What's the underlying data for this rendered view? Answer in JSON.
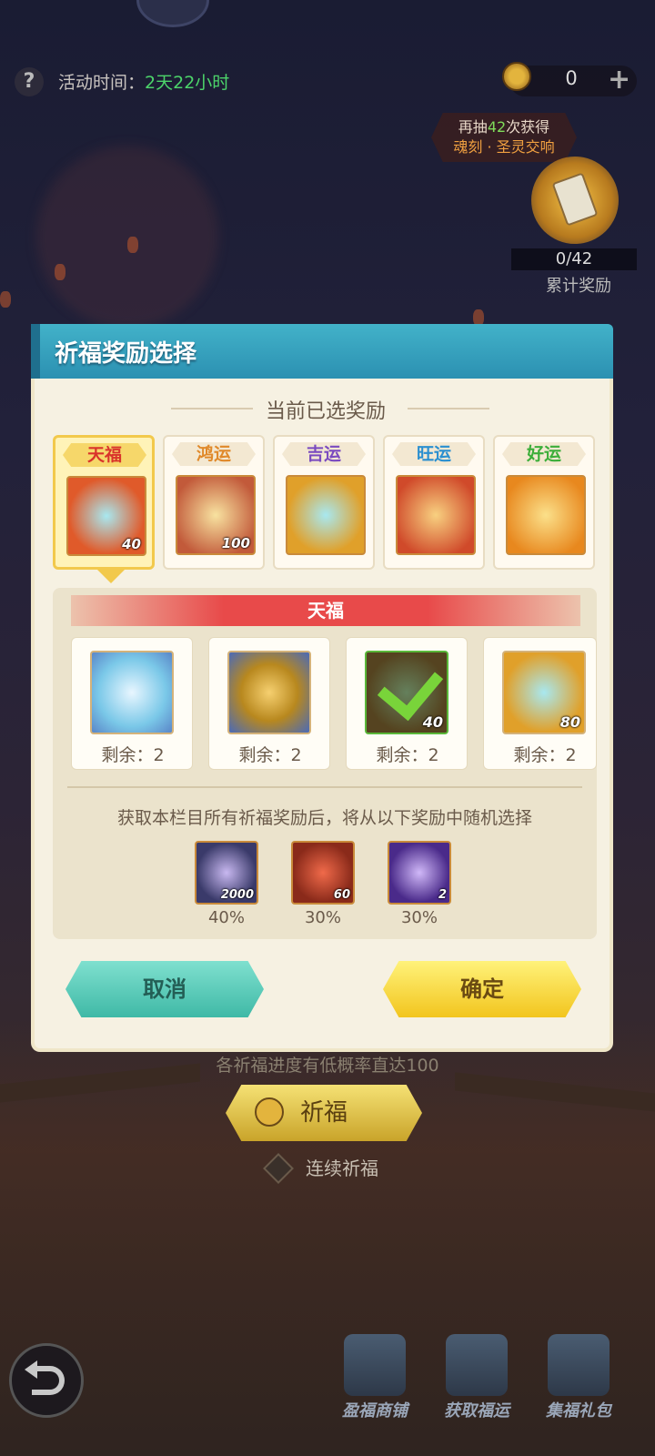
{
  "header": {
    "help_icon": "question-icon",
    "activity_time_label": "活动时间：",
    "activity_time_value": "2天22小时",
    "currency_count": "0",
    "currency_plus": "+",
    "draw_prefix": "再抽",
    "draw_count": "42",
    "draw_suffix": "次获得",
    "draw_reward_name": "魂刻 · 圣灵交响",
    "progress": "0/42",
    "progress_label": "累计奖励"
  },
  "modal": {
    "title": "祈福奖励选择",
    "section_title": "当前已选奖励",
    "tabs": [
      {
        "label": "天福",
        "count": "40",
        "color": "#d9342b",
        "active": true
      },
      {
        "label": "鸿运",
        "count": "100",
        "color": "#e0892a",
        "active": false
      },
      {
        "label": "吉运",
        "count": "",
        "color": "#7a4ac0",
        "active": false
      },
      {
        "label": "旺运",
        "count": "",
        "color": "#2a8fd0",
        "active": false
      },
      {
        "label": "好运",
        "count": "",
        "color": "#3cae3a",
        "active": false
      }
    ],
    "category_title": "天福",
    "items": [
      {
        "remaining_label": "剩余：2",
        "count": ""
      },
      {
        "remaining_label": "剩余：2",
        "count": ""
      },
      {
        "remaining_label": "剩余：2",
        "count": "40",
        "checked": true
      },
      {
        "remaining_label": "剩余：2",
        "count": "80"
      }
    ],
    "random_text": "获取本栏目所有祈福奖励后，将从以下奖励中随机选择",
    "random_items": [
      {
        "count": "2000",
        "percent": "40%"
      },
      {
        "count": "60",
        "percent": "30%"
      },
      {
        "count": "2",
        "percent": "30%"
      }
    ],
    "cancel_label": "取消",
    "confirm_label": "确定"
  },
  "below": {
    "hint_text": "各祈福进度有低概率直达100",
    "pray_label": "祈福",
    "continuous_label": "连续祈福"
  },
  "bottom_nav": [
    {
      "label": "盈福商铺",
      "icon": "shop-icon"
    },
    {
      "label": "获取福运",
      "icon": "book-icon"
    },
    {
      "label": "集福礼包",
      "icon": "gift-icon"
    }
  ]
}
